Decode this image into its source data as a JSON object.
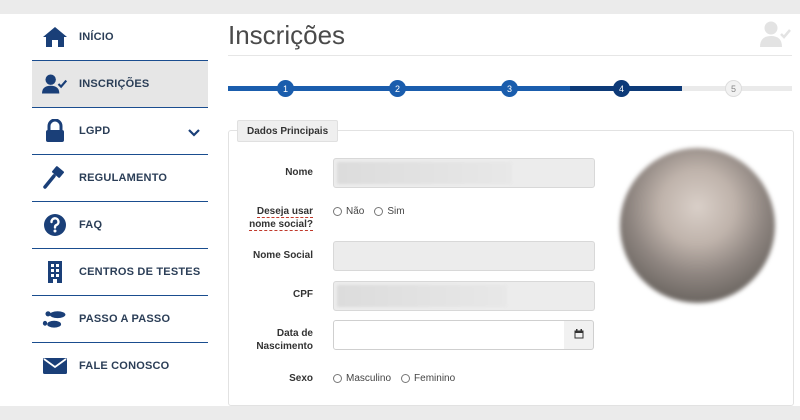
{
  "sidebar": {
    "items": [
      {
        "label": "INÍCIO",
        "icon": "home-icon"
      },
      {
        "label": "INSCRIÇÕES",
        "icon": "user-check-icon"
      },
      {
        "label": "LGPD",
        "icon": "lock-icon"
      },
      {
        "label": "REGULAMENTO",
        "icon": "gavel-icon"
      },
      {
        "label": "FAQ",
        "icon": "question-circle-icon"
      },
      {
        "label": "CENTROS DE TESTES",
        "icon": "building-icon"
      },
      {
        "label": "PASSO A PASSO",
        "icon": "footsteps-icon"
      },
      {
        "label": "FALE CONOSCO",
        "icon": "envelope-icon"
      }
    ],
    "active_index": 1
  },
  "header": {
    "title": "Inscrições"
  },
  "stepper": {
    "steps": [
      "1",
      "2",
      "3",
      "4",
      "5"
    ],
    "current_step": 4
  },
  "form": {
    "section_title": "Dados Principais",
    "fields": {
      "nome": {
        "label": "Nome"
      },
      "nome_social_question": {
        "label_line1": "Deseja usar",
        "label_line2": "nome social?"
      },
      "nome_social": {
        "label": "Nome Social"
      },
      "cpf": {
        "label": "CPF"
      },
      "data_nascimento": {
        "label_line1": "Data de",
        "label_line2": "Nascimento"
      },
      "sexo": {
        "label": "Sexo"
      }
    },
    "options": {
      "nome_social": [
        "Não",
        "Sim"
      ],
      "sexo": [
        "Masculino",
        "Feminino"
      ]
    }
  },
  "colors": {
    "primary": "#1a5dad",
    "primary_dark": "#0d3a78",
    "sidebar_icon": "#1a3f78",
    "text_dark": "#2b3e57"
  }
}
